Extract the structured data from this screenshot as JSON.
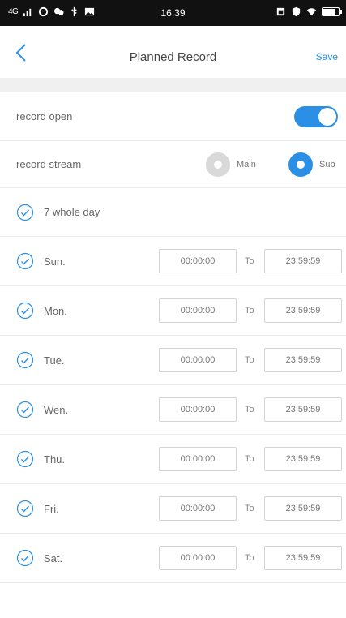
{
  "status_bar": {
    "network": "4G",
    "time": "16:39"
  },
  "nav": {
    "title": "Planned Record",
    "save_label": "Save"
  },
  "record_open": {
    "label": "record open",
    "enabled": true
  },
  "record_stream": {
    "label": "record stream",
    "options": [
      "Main",
      "Sub"
    ],
    "selected": "Sub"
  },
  "whole_day": {
    "label": "7 whole day",
    "checked": true
  },
  "to_label": "To",
  "days": [
    {
      "name": "Sun.",
      "start": "00:00:00",
      "end": "23:59:59"
    },
    {
      "name": "Mon.",
      "start": "00:00:00",
      "end": "23:59:59"
    },
    {
      "name": "Tue.",
      "start": "00:00:00",
      "end": "23:59:59"
    },
    {
      "name": "Wen.",
      "start": "00:00:00",
      "end": "23:59:59"
    },
    {
      "name": "Thu.",
      "start": "00:00:00",
      "end": "23:59:59"
    },
    {
      "name": "Fri.",
      "start": "00:00:00",
      "end": "23:59:59"
    },
    {
      "name": "Sat.",
      "start": "00:00:00",
      "end": "23:59:59"
    }
  ],
  "colors": {
    "accent": "#2b8fe6",
    "inactive": "#d9d9d9",
    "band": "#f0f0f0"
  }
}
